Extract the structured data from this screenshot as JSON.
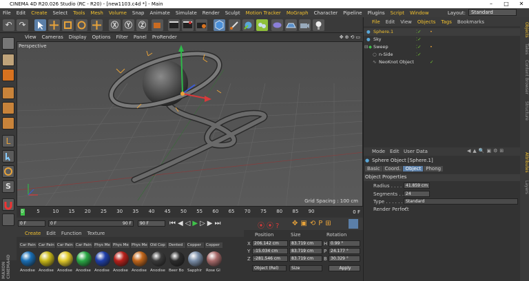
{
  "window": {
    "title": "CINEMA 4D R20.026 Studio (RC - R20) - [new1103.c4d *] - Main"
  },
  "menubar": {
    "items": [
      "File",
      "Edit",
      "Create",
      "Select",
      "Tools",
      "Mesh",
      "Volume",
      "Snap",
      "Animate",
      "Simulate",
      "Render",
      "Sculpt",
      "Motion Tracker",
      "MoGraph",
      "Character",
      "Pipeline",
      "Plugins",
      "Script",
      "Window"
    ],
    "layout_label": "Layout:",
    "layout_value": "Standard"
  },
  "viewport": {
    "menu": [
      "View",
      "Cameras",
      "Display",
      "Options",
      "Filter",
      "Panel",
      "ProRender"
    ],
    "camera_label": "Perspective",
    "grid_spacing": "Grid Spacing : 100 cm"
  },
  "timeline": {
    "ticks": [
      "0",
      "5",
      "10",
      "15",
      "20",
      "25",
      "30",
      "35",
      "40",
      "45",
      "50",
      "55",
      "60",
      "65",
      "70",
      "75",
      "80",
      "85",
      "90"
    ],
    "end_frame": "0 F"
  },
  "transport": {
    "start": "0 F",
    "current": "0 F",
    "end1": "90 F",
    "end2": "90 F"
  },
  "materials": {
    "menu": [
      "Create",
      "Edit",
      "Function",
      "Texture"
    ],
    "top_labels": [
      "Car Pain",
      "Car Pain",
      "Car Pain",
      "Car Pain",
      "Phys Me",
      "Phys Me",
      "Phys Me",
      "Old Cop",
      "Dented",
      "Copper",
      "Copper"
    ],
    "bottom_labels": [
      "Anodise",
      "Anodise",
      "Anodise",
      "Anodise",
      "Anodise",
      "Anodise",
      "Anodise",
      "Anodise",
      "Beer Bo",
      "Sapphir",
      "Rose Gl"
    ],
    "ball_colors": [
      "#1a6fb5",
      "#c9b818",
      "#e1c92a",
      "#2aa845",
      "#1f3fa8",
      "#b8201a",
      "#c2661a",
      "#3a3a3a",
      "#2c2c2c",
      "#7a8ea8",
      "#a86a6a"
    ]
  },
  "coords": {
    "headers": [
      "Position",
      "Size",
      "Rotation"
    ],
    "rows": [
      {
        "axis": "X",
        "pos": "206.142 cm",
        "size": "83.719 cm",
        "rlabel": "H",
        "rot": "0.99 °"
      },
      {
        "axis": "Y",
        "pos": "-15.034 cm",
        "size": "83.719 cm",
        "rlabel": "P",
        "rot": "24.177 °"
      },
      {
        "axis": "Z",
        "pos": "-281.546 cm",
        "size": "83.719 cm",
        "rlabel": "B",
        "rot": "30.329 °"
      }
    ],
    "mode": "Object (Rel)",
    "size_mode": "Size",
    "apply": "Apply"
  },
  "object_manager": {
    "menu": [
      "File",
      "Edit",
      "View",
      "Objects",
      "Tags",
      "Bookmarks"
    ],
    "objects": [
      "Sphere.1",
      "Sky",
      "Sweep",
      "n-Side",
      "NeoKnot Object"
    ]
  },
  "attributes": {
    "menu": [
      "Mode",
      "Edit",
      "User Data"
    ],
    "object_title": "Sphere Object [Sphere.1]",
    "tabs": [
      "Basic",
      "Coord.",
      "Object",
      "Phong"
    ],
    "section": "Object Properties",
    "fields": [
      {
        "label": "Radius . . . . . .",
        "value": "41.859 cm"
      },
      {
        "label": "Segments . . . .",
        "value": "24"
      },
      {
        "label": "Type . . . . . . . .",
        "value": "Standard"
      },
      {
        "label": "Render Perfect",
        "value": "✓"
      }
    ]
  },
  "vertical_tabs": [
    "Objects",
    "Takes",
    "Content Browser",
    "Structure",
    "Attributes",
    "Layers"
  ]
}
